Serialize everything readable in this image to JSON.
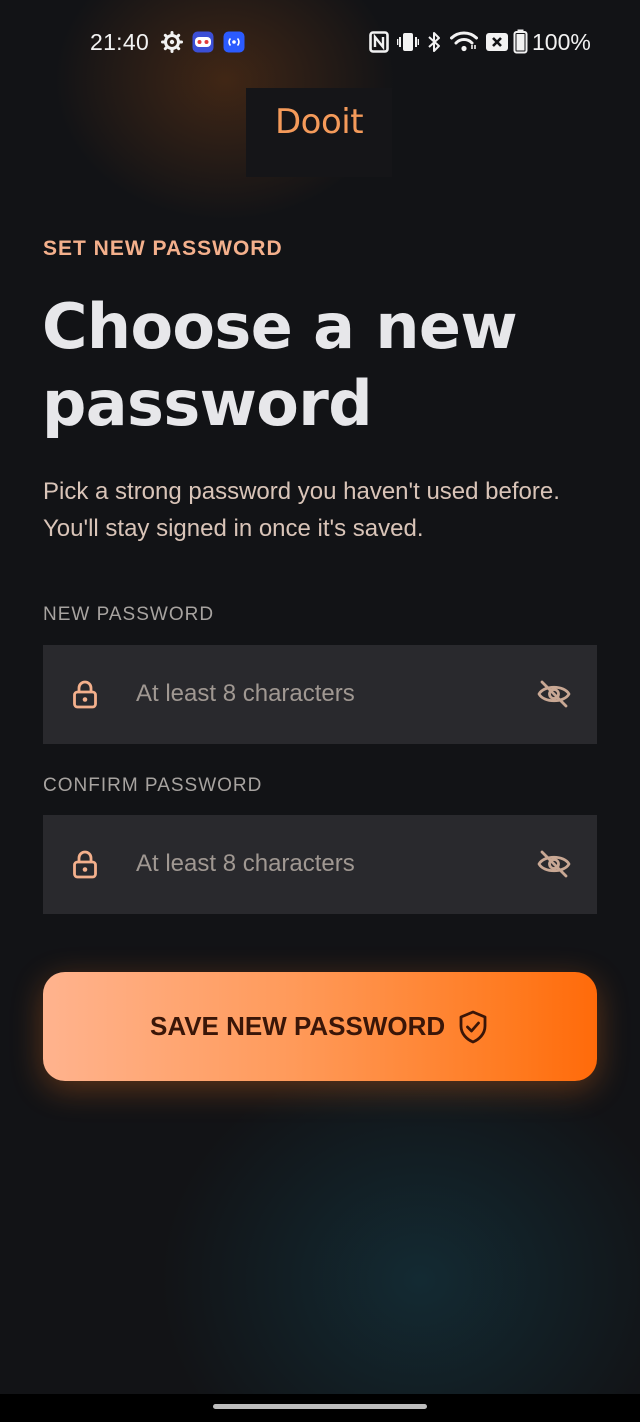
{
  "status_bar": {
    "time": "21:40",
    "battery": "100%",
    "left_icons": [
      "settings-gear-icon",
      "game-app-icon",
      "broadcast-app-icon"
    ],
    "right_icons": [
      "nfc-icon",
      "vibrate-icon",
      "bluetooth-icon",
      "wifi-icon",
      "sim-blocked-icon",
      "battery-icon"
    ]
  },
  "app": {
    "logo": "Dooit"
  },
  "page": {
    "eyebrow": "SET NEW PASSWORD",
    "title": "Choose a new password",
    "subtitle": "Pick a strong password you haven't used before. You'll stay signed in once it's saved."
  },
  "form": {
    "new_password": {
      "label": "NEW PASSWORD",
      "placeholder": "At least 8 characters",
      "value": "",
      "leading_icon": "lock-icon",
      "trailing_icon": "eye-off-icon"
    },
    "confirm_password": {
      "label": "CONFIRM PASSWORD",
      "placeholder": "At least 8 characters",
      "value": "",
      "leading_icon": "lock-icon",
      "trailing_icon": "eye-off-icon"
    },
    "submit": {
      "label": "SAVE NEW PASSWORD",
      "icon": "shield-check-icon"
    }
  },
  "colors": {
    "background": "#121316",
    "accent": "#f49a5a",
    "eyebrow": "#f4b08c",
    "field_bg": "#29292d",
    "button_gradient_start": "#ffb38e",
    "button_gradient_end": "#ff6a0a",
    "button_text": "#3a1608"
  }
}
